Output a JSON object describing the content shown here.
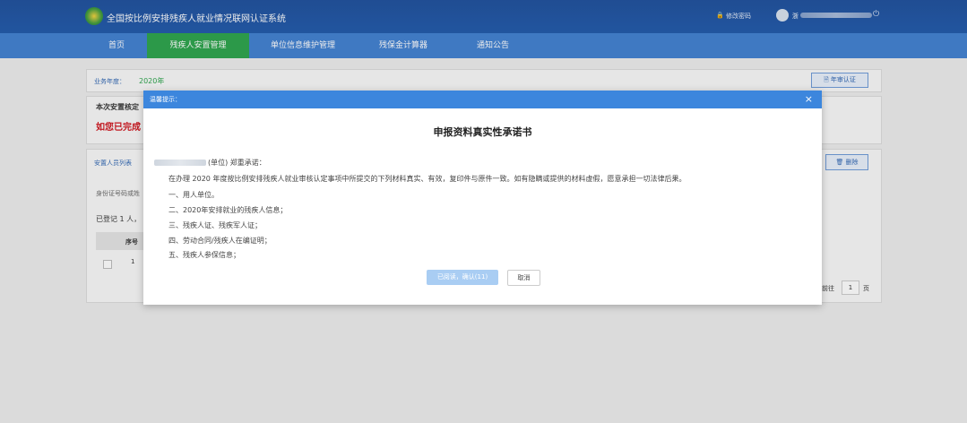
{
  "header": {
    "title": "全国按比例安排残疾人就业情况联网认证系统",
    "change_password": "修改密码",
    "user_name_prefix": "浙"
  },
  "nav": {
    "items": [
      {
        "label": "首页"
      },
      {
        "label": "残疾人安置管理"
      },
      {
        "label": "单位信息维护管理"
      },
      {
        "label": "残保金计算器"
      },
      {
        "label": "通知公告"
      }
    ]
  },
  "business": {
    "year_label": "业务年度：",
    "year_value": "2020年",
    "annual_button": "年审认证"
  },
  "status": {
    "title": "本次安置核定",
    "warning": "如您已完成"
  },
  "list": {
    "title": "安置人员列表",
    "delete_button": "删除",
    "id_hint": "身份证号码或姓",
    "registered": "已登记 1 人，",
    "col_seq": "序号",
    "row_seq": "1",
    "pager_total": "前往",
    "pager_page": "1",
    "pager_unit": "页"
  },
  "modal": {
    "head_title": "温馨提示：",
    "close_glyph": "×",
    "doc_title": "申报资料真实性承诺书",
    "salutation": "(单位) 郑重承诺：",
    "body": "在办理 2020 年度按比例安排残疾人就业审核认定事项中所提交的下列材料真实、有效，复印件与原件一致。如有隐瞒或提供的材料虚假，愿意承担一切法律后果。",
    "items": [
      "一、用人单位。",
      "二、2020年安排就业的残疾人信息；",
      "三、残疾人证、残疾军人证；",
      "四、劳动合同/残疾人在编证明；",
      "五、残疾人参保信息；"
    ],
    "confirm_button": "已阅读，确认(11)",
    "cancel_button": "取消"
  }
}
